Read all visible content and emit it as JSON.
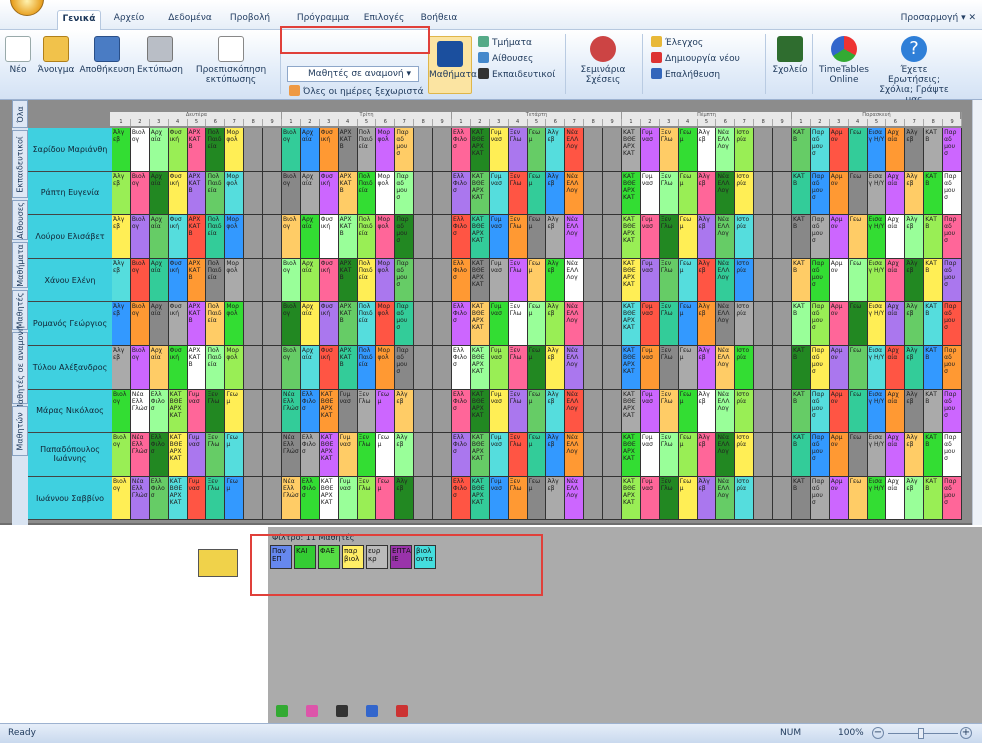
{
  "tabs": [
    "Γενικά",
    "Αρχείο",
    "Δεδομένα",
    "Προβολή",
    "Πρόγραμμα",
    "Επιλογές",
    "Βοήθεια"
  ],
  "customize": "Προσαρμογή",
  "ribbon": {
    "new": "Νέο",
    "open": "Άνοιγμα",
    "save": "Αποθήκευση",
    "print": "Εκτύπωση",
    "preview": "Προεπισκόπηση εκτύπωσης",
    "view_combo": "Μαθητές σε αναμονή",
    "all_days": "Όλες οι ημέρες ξεχωριστά",
    "subjects": "Μαθήματα",
    "classes": "Τμήματα",
    "rooms": "Αίθουσες",
    "teachers": "Εκπαιδευτικοί",
    "seminars": "Σεμινάρια Σχέσεις",
    "check": "Έλεγχος",
    "create_new": "Δημιουργία νέου",
    "verify": "Επαλήθευση",
    "school": "Σχολείο",
    "timetables_online": "TimeTables Online",
    "questions": "Έχετε Ερωτήσεις; Σχόλια; Γράψτε μας"
  },
  "side_tabs": [
    "Όλα",
    "Εκπαιδευτικοί",
    "Αίθουσες",
    "Μαθήματα",
    "Μαθητές",
    "Μαθητές σε αναμονή",
    "Μαθητών"
  ],
  "days": [
    "Δευτέρα",
    "Τρίτη",
    "Τετάρτη",
    "Πέμπτη",
    "Παρασκευή"
  ],
  "period_numbers": [
    "1",
    "2",
    "3",
    "4",
    "5",
    "6",
    "7",
    "8",
    "9"
  ],
  "rows": [
    {
      "name": "Σαρίδου Μαριάνθη"
    },
    {
      "name": "Ράπτη Ευγενία"
    },
    {
      "name": "Λούρου Ελισάβετ"
    },
    {
      "name": "Χάνου Ελένη"
    },
    {
      "name": "Ρομανός Γεώργιος"
    },
    {
      "name": "Τύλου Αλέξανδρος"
    },
    {
      "name": "Μάρας Νικόλαος"
    },
    {
      "name": "Παπαδόπουλος Ιωάννης"
    },
    {
      "name": "Ιωάννου Σαββίνο"
    }
  ],
  "cell_labels_a": [
    "Άλγ εβ",
    "Βιολ ογ",
    "Αρχ αία",
    "Φυσ ική",
    "ΑΡΧ ΚΑΤ Β",
    "Πολ Παιδ εία",
    "Μορ φολ",
    "Παρ αδ μου σ",
    "Χημ εία",
    "Φυσ ική",
    "Θρη σκε υτ",
    "ΑΡΧ ΚΑΤ Τ",
    "PRO JEC Τ",
    "Νέα Ελλ Λογ",
    "Ιστο ρία",
    "Ξένο"
  ],
  "cell_labels_b": [
    "Βιολ ογ",
    "Νέα Ελλ Γλώσ",
    "Ελλ Φιλο σ",
    "ΚΑΤ ΒΘΕ ΑΡΧ ΚΑΤ",
    "Γυμ νασ",
    "Ξεν Γλω",
    "Γεω μ",
    "Άλγ εβ",
    "Νέα ΕΛΛ Λογ",
    "Ιστο ρία",
    "ΚΑΤ ΒΘΕ",
    "Χημ εία",
    "DICT E",
    "Αρμ ον",
    "Ξένο"
  ],
  "cell_labels_c": [
    "Γεω",
    "Εισα γ Η/Υ",
    "Αρχ αία",
    "Άλγ εβ",
    "ΚΑΤ Β",
    "Παρ αδ μου σ",
    "Αρμ ον"
  ],
  "filter_title": "Φίλτρο: 11 Μαθητές",
  "filter_chips": [
    "Παν ΕΠ",
    "ΚΑΙ",
    "ΦΑΕ",
    "παρ βιολ",
    "ευρ κρ",
    "ΕΠΤΑ ΙΕ",
    "βιολ οντα"
  ],
  "status": {
    "ready": "Ready",
    "num": "NUM",
    "zoom": "100%"
  },
  "colors": {
    "accent": "#1e395b",
    "highlight": "#e0403a",
    "name_col": "#3fd0e0"
  }
}
